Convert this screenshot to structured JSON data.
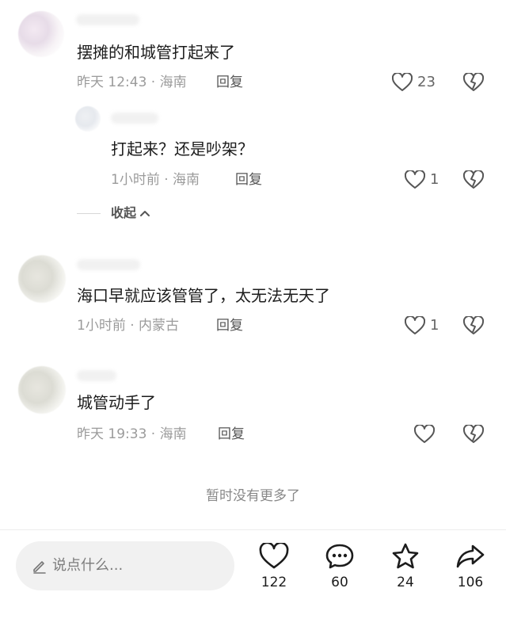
{
  "comments": [
    {
      "text": "摆摊的和城管打起来了",
      "meta": "昨天 12:43 · 海南",
      "reply": "回复",
      "likes": "23",
      "replies": [
        {
          "text": "打起来？还是吵架？",
          "meta": "1小时前 · 海南",
          "reply": "回复",
          "likes": "1"
        }
      ],
      "collapse_label": "收起"
    },
    {
      "text": "海口早就应该管管了，太无法无天了",
      "meta": "1小时前 · 内蒙古",
      "reply": "回复",
      "likes": "1"
    },
    {
      "text": "城管动手了",
      "meta": "昨天 19:33 · 海南",
      "reply": "回复",
      "likes": ""
    }
  ],
  "no_more_text": "暂时没有更多了",
  "bottom_bar": {
    "input_placeholder": "说点什么...",
    "like_count": "122",
    "comment_count": "60",
    "favorite_count": "24",
    "share_count": "106"
  },
  "icons": {
    "heart": "heart-icon",
    "dislike": "broken-heart-icon",
    "chevron": "chevron-up-icon",
    "pen": "pen-icon",
    "comment": "comment-bubble-icon",
    "star": "star-icon",
    "share": "share-arrow-icon"
  },
  "colors": {
    "meta_text": "#9b9b9b",
    "input_bg": "#f1f1f1"
  }
}
